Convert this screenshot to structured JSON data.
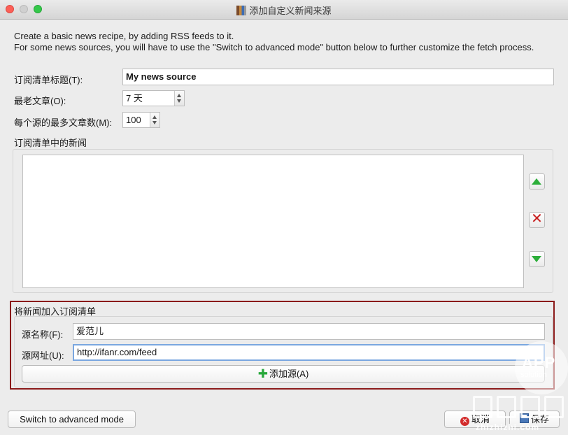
{
  "window": {
    "title": "添加自定义新闻来源"
  },
  "intro": {
    "line1": "Create a basic news recipe, by adding RSS feeds to it.",
    "line2": "For some news sources, you will have to use the \"Switch to advanced mode\" button below to further customize the fetch process."
  },
  "recipe_title": {
    "label": "订阅清单标题(T):",
    "value": "My news source"
  },
  "oldest_article": {
    "label": "最老文章(O):",
    "value": "7 天"
  },
  "max_articles": {
    "label": "每个源的最多文章数(M):",
    "value": "100"
  },
  "feeds_list": {
    "label": "订阅清单中的新闻",
    "items": []
  },
  "add_feed": {
    "group_label": "将新闻加入订阅清单",
    "name_label": "源名称(F):",
    "name_value": "爱范儿",
    "url_label": "源网址(U):",
    "url_value": "http://ifanr.com/feed",
    "add_button": "添加源(A)"
  },
  "footer": {
    "advanced_button": "Switch to advanced mode",
    "cancel_button": "取消",
    "save_button": "保存"
  },
  "watermark": {
    "line1": "APP",
    "line2": "solution",
    "line3": "zhizhizhi.com"
  },
  "icons": {
    "move_up": "arrow-up-icon",
    "remove": "remove-x-icon",
    "move_down": "arrow-down-icon",
    "add": "plus-icon",
    "cancel": "cancel-icon",
    "save": "save-icon"
  },
  "colors": {
    "highlight_border": "#8b1a1a",
    "green": "#2cae3a",
    "red": "#c81e1e"
  }
}
